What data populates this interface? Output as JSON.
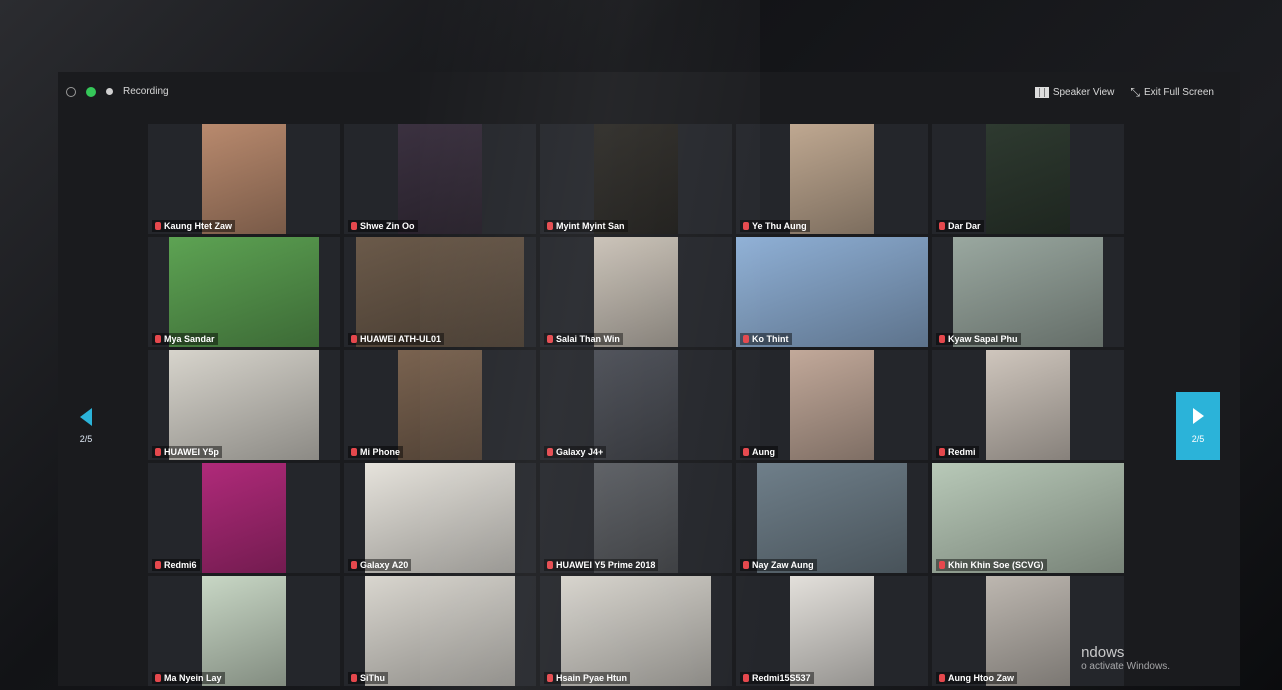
{
  "topbar": {
    "recording_label": "Recording",
    "speaker_view_label": "Speaker View",
    "exit_fullscreen_label": "Exit Full Screen"
  },
  "nav": {
    "prev_page": "2/5",
    "next_page": "2/5"
  },
  "participants": [
    {
      "name": "Kaung Htet Zaw",
      "color": "#b98a6e"
    },
    {
      "name": "Shwe Zin Oo",
      "color": "#3b3140"
    },
    {
      "name": "Myint Myint San",
      "color": "#2c2a26"
    },
    {
      "name": "Ye Thu Aung",
      "color": "#bfa891"
    },
    {
      "name": "Dar Dar",
      "color": "#2e3a30"
    },
    {
      "name": "Mya Sandar",
      "color": "#5da353"
    },
    {
      "name": "HUAWEI ATH-UL01",
      "color": "#6b5a4a"
    },
    {
      "name": "Salai Than Win",
      "color": "#c9c1b6"
    },
    {
      "name": "Ko Thint",
      "color": "#8fb0d6"
    },
    {
      "name": "Kyaw Sapal Phu",
      "color": "#9aa8a0"
    },
    {
      "name": "HUAWEI Y5p",
      "color": "#d7d4cc"
    },
    {
      "name": "Mi Phone",
      "color": "#7a6350"
    },
    {
      "name": "Galaxy J4+",
      "color": "#4a4d55"
    },
    {
      "name": "Aung",
      "color": "#c2a99a"
    },
    {
      "name": "Redmi",
      "color": "#cfc6bd"
    },
    {
      "name": "Redmi6",
      "color": "#b02a7a"
    },
    {
      "name": "Galaxy A20",
      "color": "#e6e3dc"
    },
    {
      "name": "HUAWEI Y5 Prime 2018",
      "color": "#5a5d62"
    },
    {
      "name": "Nay Zaw Aung",
      "color": "#6f7f8a"
    },
    {
      "name": "Khin Khin Soe (SCVG)",
      "color": "#b8c9b8"
    },
    {
      "name": "Ma Nyein Lay",
      "color": "#c8d7c5"
    },
    {
      "name": "SiThu",
      "color": "#d9d6cf"
    },
    {
      "name": "Hsain Pyae Htun",
      "color": "#d6d3cc"
    },
    {
      "name": "Redmi15S537",
      "color": "#e3e0db"
    },
    {
      "name": "Aung Htoo Zaw",
      "color": "#bdb7b0"
    }
  ],
  "watermark": {
    "title": "ndows",
    "subtitle": "o activate Windows."
  }
}
